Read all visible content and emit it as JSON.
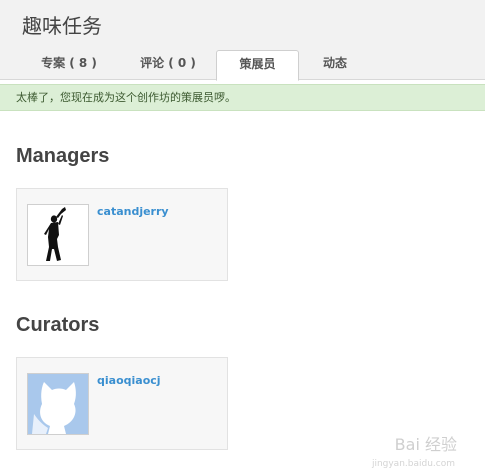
{
  "studio": {
    "title": "趣味任务"
  },
  "tabs": [
    {
      "label": "专案 ( 8 )"
    },
    {
      "label": "评论 ( 0 )"
    },
    {
      "label": "策展员"
    },
    {
      "label": "动态"
    }
  ],
  "active_tab": "策展员",
  "alert": {
    "message": "太棒了，您现在成为这个创作坊的策展员啰。"
  },
  "managers": {
    "heading": "Managers",
    "members": [
      {
        "username": "catandjerry",
        "avatar": "dancer-silhouette-image"
      }
    ]
  },
  "curators": {
    "heading": "Curators",
    "members": [
      {
        "username": "qiaoqiaocj",
        "avatar": "scratch-cat-image"
      }
    ]
  },
  "watermark": {
    "text": "Bai 经验",
    "sub": "jingyan.baidu.com"
  },
  "colors": {
    "header_bg": "#f2f2f2",
    "alert_bg": "#dcefd6",
    "link": "#3a8fd0",
    "card_bg": "#f7f7f7"
  }
}
